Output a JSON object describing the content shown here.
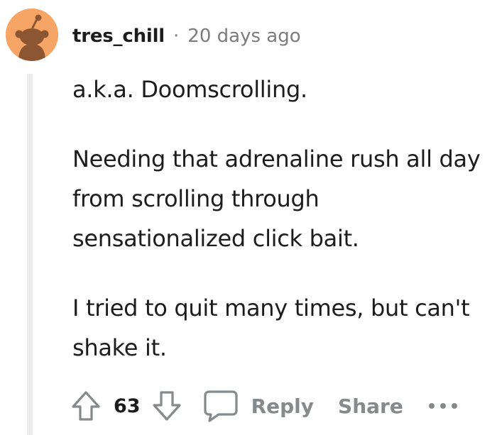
{
  "comment": {
    "username": "tres_chill",
    "separator": "·",
    "timestamp": "20 days ago",
    "paragraphs": [
      "a.k.a. Doomscrolling.",
      "Needing that adrenaline rush all day from scrolling through sensationalized click bait.",
      "I tried to quit many times, but can't shake it."
    ]
  },
  "actions": {
    "upvote_icon": "upvote-arrow-icon",
    "vote_count": "63",
    "downvote_icon": "downvote-arrow-icon",
    "reply_icon": "speech-bubble-icon",
    "reply_label": "Reply",
    "share_label": "Share",
    "more_icon": "ellipsis-icon"
  },
  "colors": {
    "avatar_bg": "#f7a566",
    "text": "#1c1c1c",
    "meta_gray": "#7c7c7c",
    "action_gray": "#878a8c",
    "thread_line": "#ececec"
  }
}
